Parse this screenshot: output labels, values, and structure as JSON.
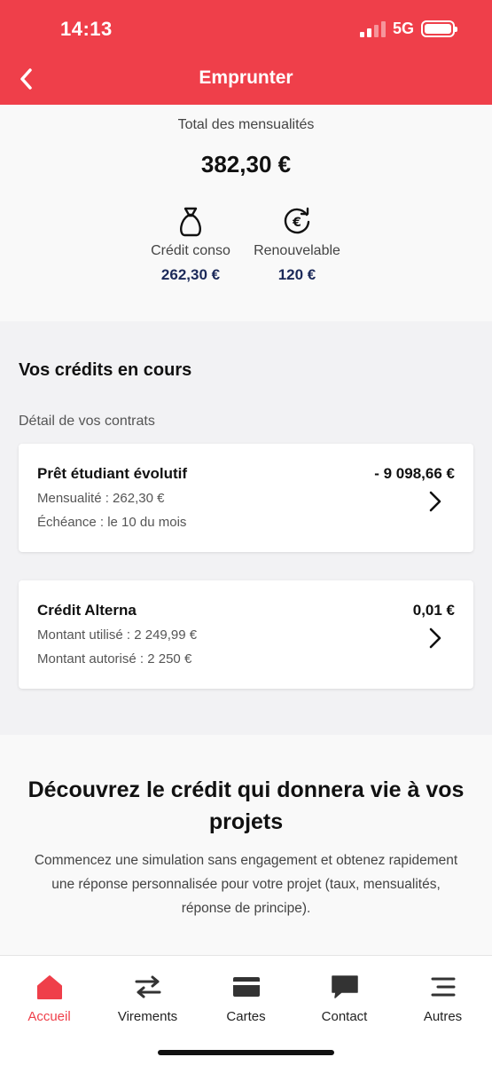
{
  "status_bar": {
    "time": "14:13",
    "network": "5G"
  },
  "header": {
    "title": "Emprunter",
    "back_icon": "chevron-left-icon"
  },
  "summary": {
    "label": "Total des mensualités",
    "total": "382,30 €",
    "items": [
      {
        "name": "Crédit conso",
        "value": "262,30 €",
        "icon": "money-bag-icon"
      },
      {
        "name": "Renouvelable",
        "value": "120 €",
        "icon": "euro-renew-icon"
      }
    ]
  },
  "credits": {
    "title": "Vos crédits en cours",
    "subtitle": "Détail de vos contrats",
    "contracts": [
      {
        "name": "Prêt étudiant évolutif",
        "amount": "- 9 098,66 €",
        "line1": "Mensualité : 262,30 €",
        "line2": "Échéance : le 10 du mois"
      },
      {
        "name": "Crédit Alterna",
        "amount": "0,01 €",
        "line1": "Montant utilisé : 2 249,99 €",
        "line2": "Montant autorisé : 2 250 €"
      }
    ]
  },
  "promo": {
    "title": "Découvrez le crédit qui donnera vie à vos projets",
    "text": "Commencez une simulation sans engagement et obtenez rapidement une réponse personnalisée pour votre projet (taux, mensualités, réponse de principe)."
  },
  "tabbar": {
    "items": [
      {
        "label": "Accueil",
        "icon": "home-icon",
        "active": true
      },
      {
        "label": "Virements",
        "icon": "transfer-icon",
        "active": false
      },
      {
        "label": "Cartes",
        "icon": "card-icon",
        "active": false
      },
      {
        "label": "Contact",
        "icon": "chat-icon",
        "active": false
      },
      {
        "label": "Autres",
        "icon": "menu-icon",
        "active": false
      }
    ]
  },
  "colors": {
    "brand": "#ef3f4a",
    "amount_blue": "#1c2a5a"
  }
}
